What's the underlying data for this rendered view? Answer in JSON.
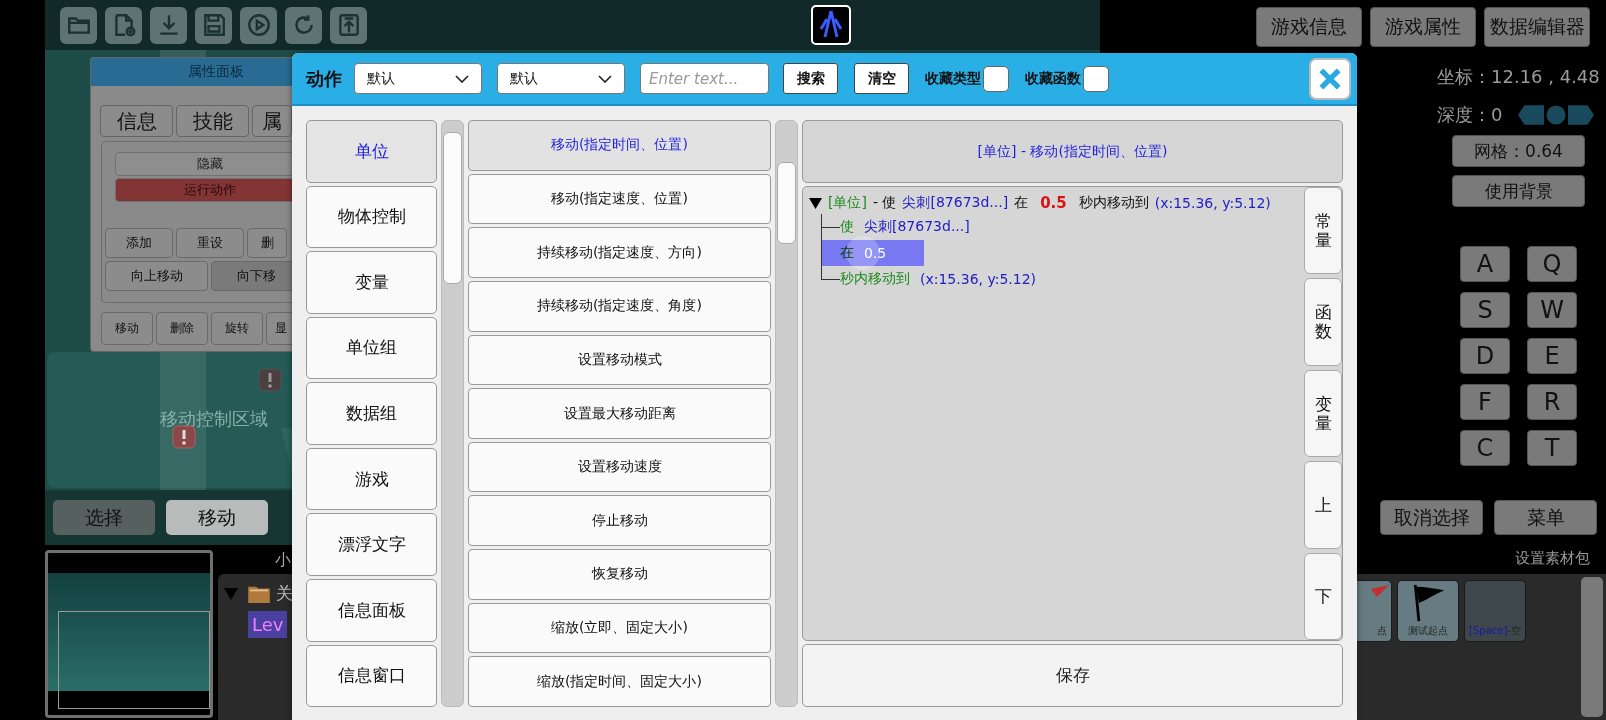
{
  "top_buttons": [
    "游戏信息",
    "游戏属性",
    "数据编辑器"
  ],
  "coordinates": "坐标：12.16 , 4.48",
  "depth": "深度：0",
  "grid_button": "网格：0.64",
  "background_button": "使用背景",
  "keys": [
    "A",
    "Q",
    "S",
    "W",
    "D",
    "E",
    "F",
    "R",
    "C",
    "T"
  ],
  "right_buttons": [
    "取消选择",
    "菜单"
  ],
  "asset_pack_link": "设置素材包",
  "tiles": [
    {
      "kind": "red-flag",
      "label": "点"
    },
    {
      "kind": "black-flag",
      "label": "测试起点"
    },
    {
      "kind": "empty",
      "key": "[Space]",
      "label": "-空"
    }
  ],
  "canvas": {
    "zone_label": "移动控制区域"
  },
  "mode_buttons": [
    {
      "label": "选择",
      "selected": false
    },
    {
      "label": "移动",
      "selected": true
    }
  ],
  "layer_panel": {
    "header": "小",
    "folder": {
      "label": "关",
      "expanded": true
    },
    "tag": "Lev"
  },
  "property_panel": {
    "title": "属性面板",
    "tabs": [
      "信息",
      "技能",
      "属"
    ],
    "actions": [
      {
        "label": "隐藏",
        "kind": "normal"
      },
      {
        "label": "运行动作",
        "kind": "danger"
      }
    ],
    "row1": [
      "添加",
      "重设",
      "删"
    ],
    "row2": [
      "向上移动",
      "向下移"
    ],
    "row3": [
      "移动",
      "删除",
      "旋转",
      "显"
    ]
  },
  "dialog": {
    "title": "动作",
    "filters": [
      "默认",
      "默认"
    ],
    "search": {
      "placeholder": "Enter text..."
    },
    "buttons": [
      "搜索",
      "清空"
    ],
    "checkboxes": [
      {
        "label": "收藏类型",
        "checked": false
      },
      {
        "label": "收藏函数",
        "checked": false
      }
    ],
    "categories": [
      {
        "label": "单位",
        "selected": true
      },
      {
        "label": "物体控制",
        "selected": false
      },
      {
        "label": "变量",
        "selected": false
      },
      {
        "label": "单位组",
        "selected": false
      },
      {
        "label": "数据组",
        "selected": false
      },
      {
        "label": "游戏",
        "selected": false
      },
      {
        "label": "漂浮文字",
        "selected": false
      },
      {
        "label": "信息面板",
        "selected": false
      },
      {
        "label": "信息窗口",
        "selected": false
      }
    ],
    "actions": [
      {
        "label": "移动(指定时间、位置)",
        "selected": true
      },
      {
        "label": "移动(指定速度、位置)",
        "selected": false
      },
      {
        "label": "持续移动(指定速度、方向)",
        "selected": false
      },
      {
        "label": "持续移动(指定速度、角度)",
        "selected": false
      },
      {
        "label": "设置移动模式",
        "selected": false
      },
      {
        "label": "设置最大移动距离",
        "selected": false
      },
      {
        "label": "设置移动速度",
        "selected": false
      },
      {
        "label": "停止移动",
        "selected": false
      },
      {
        "label": "恢复移动",
        "selected": false
      },
      {
        "label": "缩放(立即、固定大小)",
        "selected": false
      },
      {
        "label": "缩放(指定时间、固定大小)",
        "selected": false
      }
    ],
    "selected_title": "[单位] - 移动(指定时间、位置)",
    "tree": {
      "expanded": true,
      "segments": [
        {
          "text": "[单位]",
          "kind": "category"
        },
        {
          "text": "- 使",
          "kind": "plain"
        },
        {
          "text": "尖刺[87673d...]",
          "kind": "value"
        },
        {
          "text": "在",
          "kind": "plain"
        },
        {
          "text": "0.5",
          "kind": "number"
        },
        {
          "text": "秒内移动到",
          "kind": "plain"
        },
        {
          "text": "(x:15.36, y:5.12)",
          "kind": "value"
        }
      ],
      "children": [
        {
          "label": "使",
          "value": "尖刺[87673d...]",
          "selected": false
        },
        {
          "label": "在",
          "value": "0.5",
          "selected": true
        },
        {
          "label": "秒内移动到",
          "value": "(x:15.36, y:5.12)",
          "selected": false
        }
      ]
    },
    "side_tabs": [
      "常量",
      "函数",
      "变量",
      "上",
      "下"
    ],
    "save_button": "保存"
  }
}
